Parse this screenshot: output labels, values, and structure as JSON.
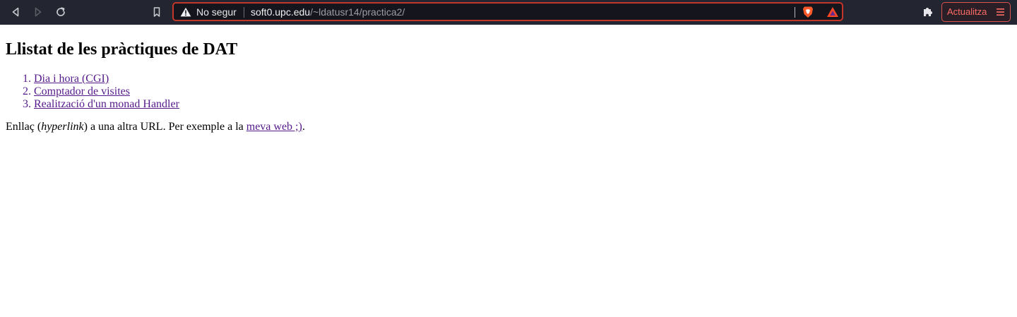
{
  "browser": {
    "toolbar_color": "#232530",
    "back_icon": "back-arrow-icon",
    "forward_icon": "forward-arrow-icon",
    "reload_icon": "reload-icon",
    "bookmark_icon": "bookmark-icon",
    "address_bar": {
      "security_label": "No segur",
      "url_host": "soft0.upc.edu",
      "url_path": "/~ldatusr14/practica2/",
      "border_color": "#c4352a"
    },
    "extensions_icon": "puzzle-icon",
    "update_button_label": "Actualitza",
    "update_button_color": "#ff6b66"
  },
  "page": {
    "title": "Llistat de les pràctiques de DAT",
    "links": [
      {
        "label": "Dia i hora (CGI)"
      },
      {
        "label": "Comptador de visites"
      },
      {
        "label": "Realització d'un monad Handler"
      }
    ],
    "paragraph": {
      "before": "Enllaç (",
      "emphasis": "hyperlink",
      "middle": ") a una altra URL. Per exemple a la ",
      "link_label": "meva web ;)",
      "after": "."
    },
    "link_color": "#551a8b"
  }
}
